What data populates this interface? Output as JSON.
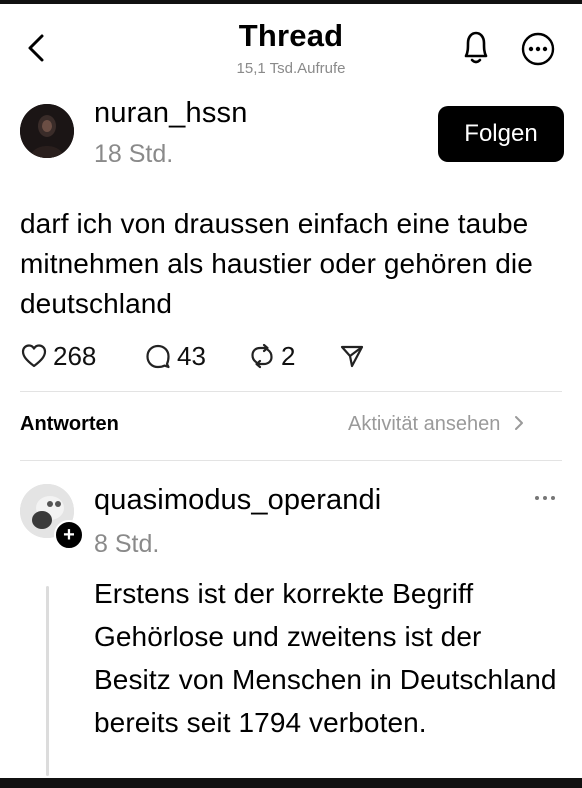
{
  "header": {
    "title": "Thread",
    "views": "15,1 Tsd.Aufrufe",
    "icons": [
      "chevron-left-icon",
      "bell-icon",
      "more-icon"
    ]
  },
  "post": {
    "username": "nuran_hssn",
    "time": "18 Std.",
    "follow_label": "Folgen",
    "text": "darf ich von draussen einfach eine taube mitnehmen als haustier oder gehören die deutschland",
    "likes": "268",
    "comments": "43",
    "reposts": "2"
  },
  "replies_bar": {
    "label": "Antworten",
    "activity_link": "Aktivität ansehen"
  },
  "reply": {
    "username": "quasimodus_operandi",
    "time": "8 Std.",
    "text": "Erstens ist der korrekte Begriff Gehörlose und zweitens ist der Besitz von Menschen in Deutschland bereits seit 1794 verboten."
  }
}
